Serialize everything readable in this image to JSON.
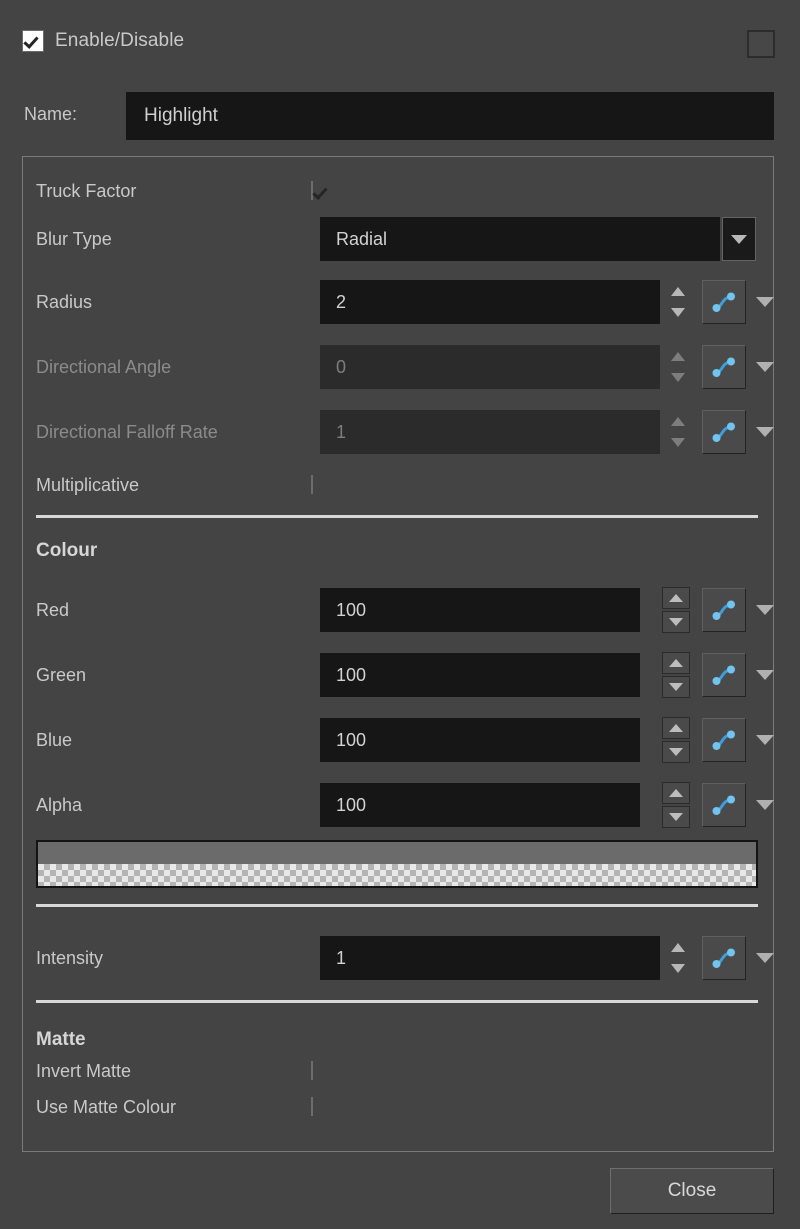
{
  "window": {
    "enable_label": "Enable/Disable",
    "enable_checked": true,
    "name_label": "Name:",
    "name_value": "Highlight",
    "close_label": "Close"
  },
  "colors": {
    "panel_bg": "#444444",
    "field_bg": "#161616",
    "field_bg_disabled": "#2b2b2b",
    "text": "#c9c9c9",
    "text_disabled": "#8b8b8b",
    "separator": "#d8d8d8",
    "curve_accent": "#4aa8e0",
    "swatch_solid": "#6b6b6b"
  },
  "properties": {
    "truck_factor": {
      "label": "Truck Factor",
      "checked": true
    },
    "blur_type": {
      "label": "Blur Type",
      "value": "Radial"
    },
    "radius": {
      "label": "Radius",
      "value": "2",
      "disabled": false
    },
    "directional_angle": {
      "label": "Directional Angle",
      "value": "0",
      "disabled": true
    },
    "directional_falloff_rate": {
      "label": "Directional Falloff Rate",
      "value": "1",
      "disabled": true
    },
    "multiplicative": {
      "label": "Multiplicative",
      "checked": false
    }
  },
  "colour_section": {
    "title": "Colour",
    "red": {
      "label": "Red",
      "value": "100"
    },
    "green": {
      "label": "Green",
      "value": "100"
    },
    "blue": {
      "label": "Blue",
      "value": "100"
    },
    "alpha": {
      "label": "Alpha",
      "value": "100"
    }
  },
  "intensity": {
    "label": "Intensity",
    "value": "1"
  },
  "matte_section": {
    "title": "Matte",
    "invert_matte": {
      "label": "Invert Matte",
      "checked": false
    },
    "use_matte_colour": {
      "label": "Use Matte Colour",
      "checked": false
    }
  },
  "icons": {
    "checkmark": "check-icon",
    "dropdown_arrow": "chevron-down-icon",
    "spinner_up": "arrow-up-icon",
    "spinner_down": "arrow-down-icon",
    "function_curve": "function-curve-icon"
  }
}
